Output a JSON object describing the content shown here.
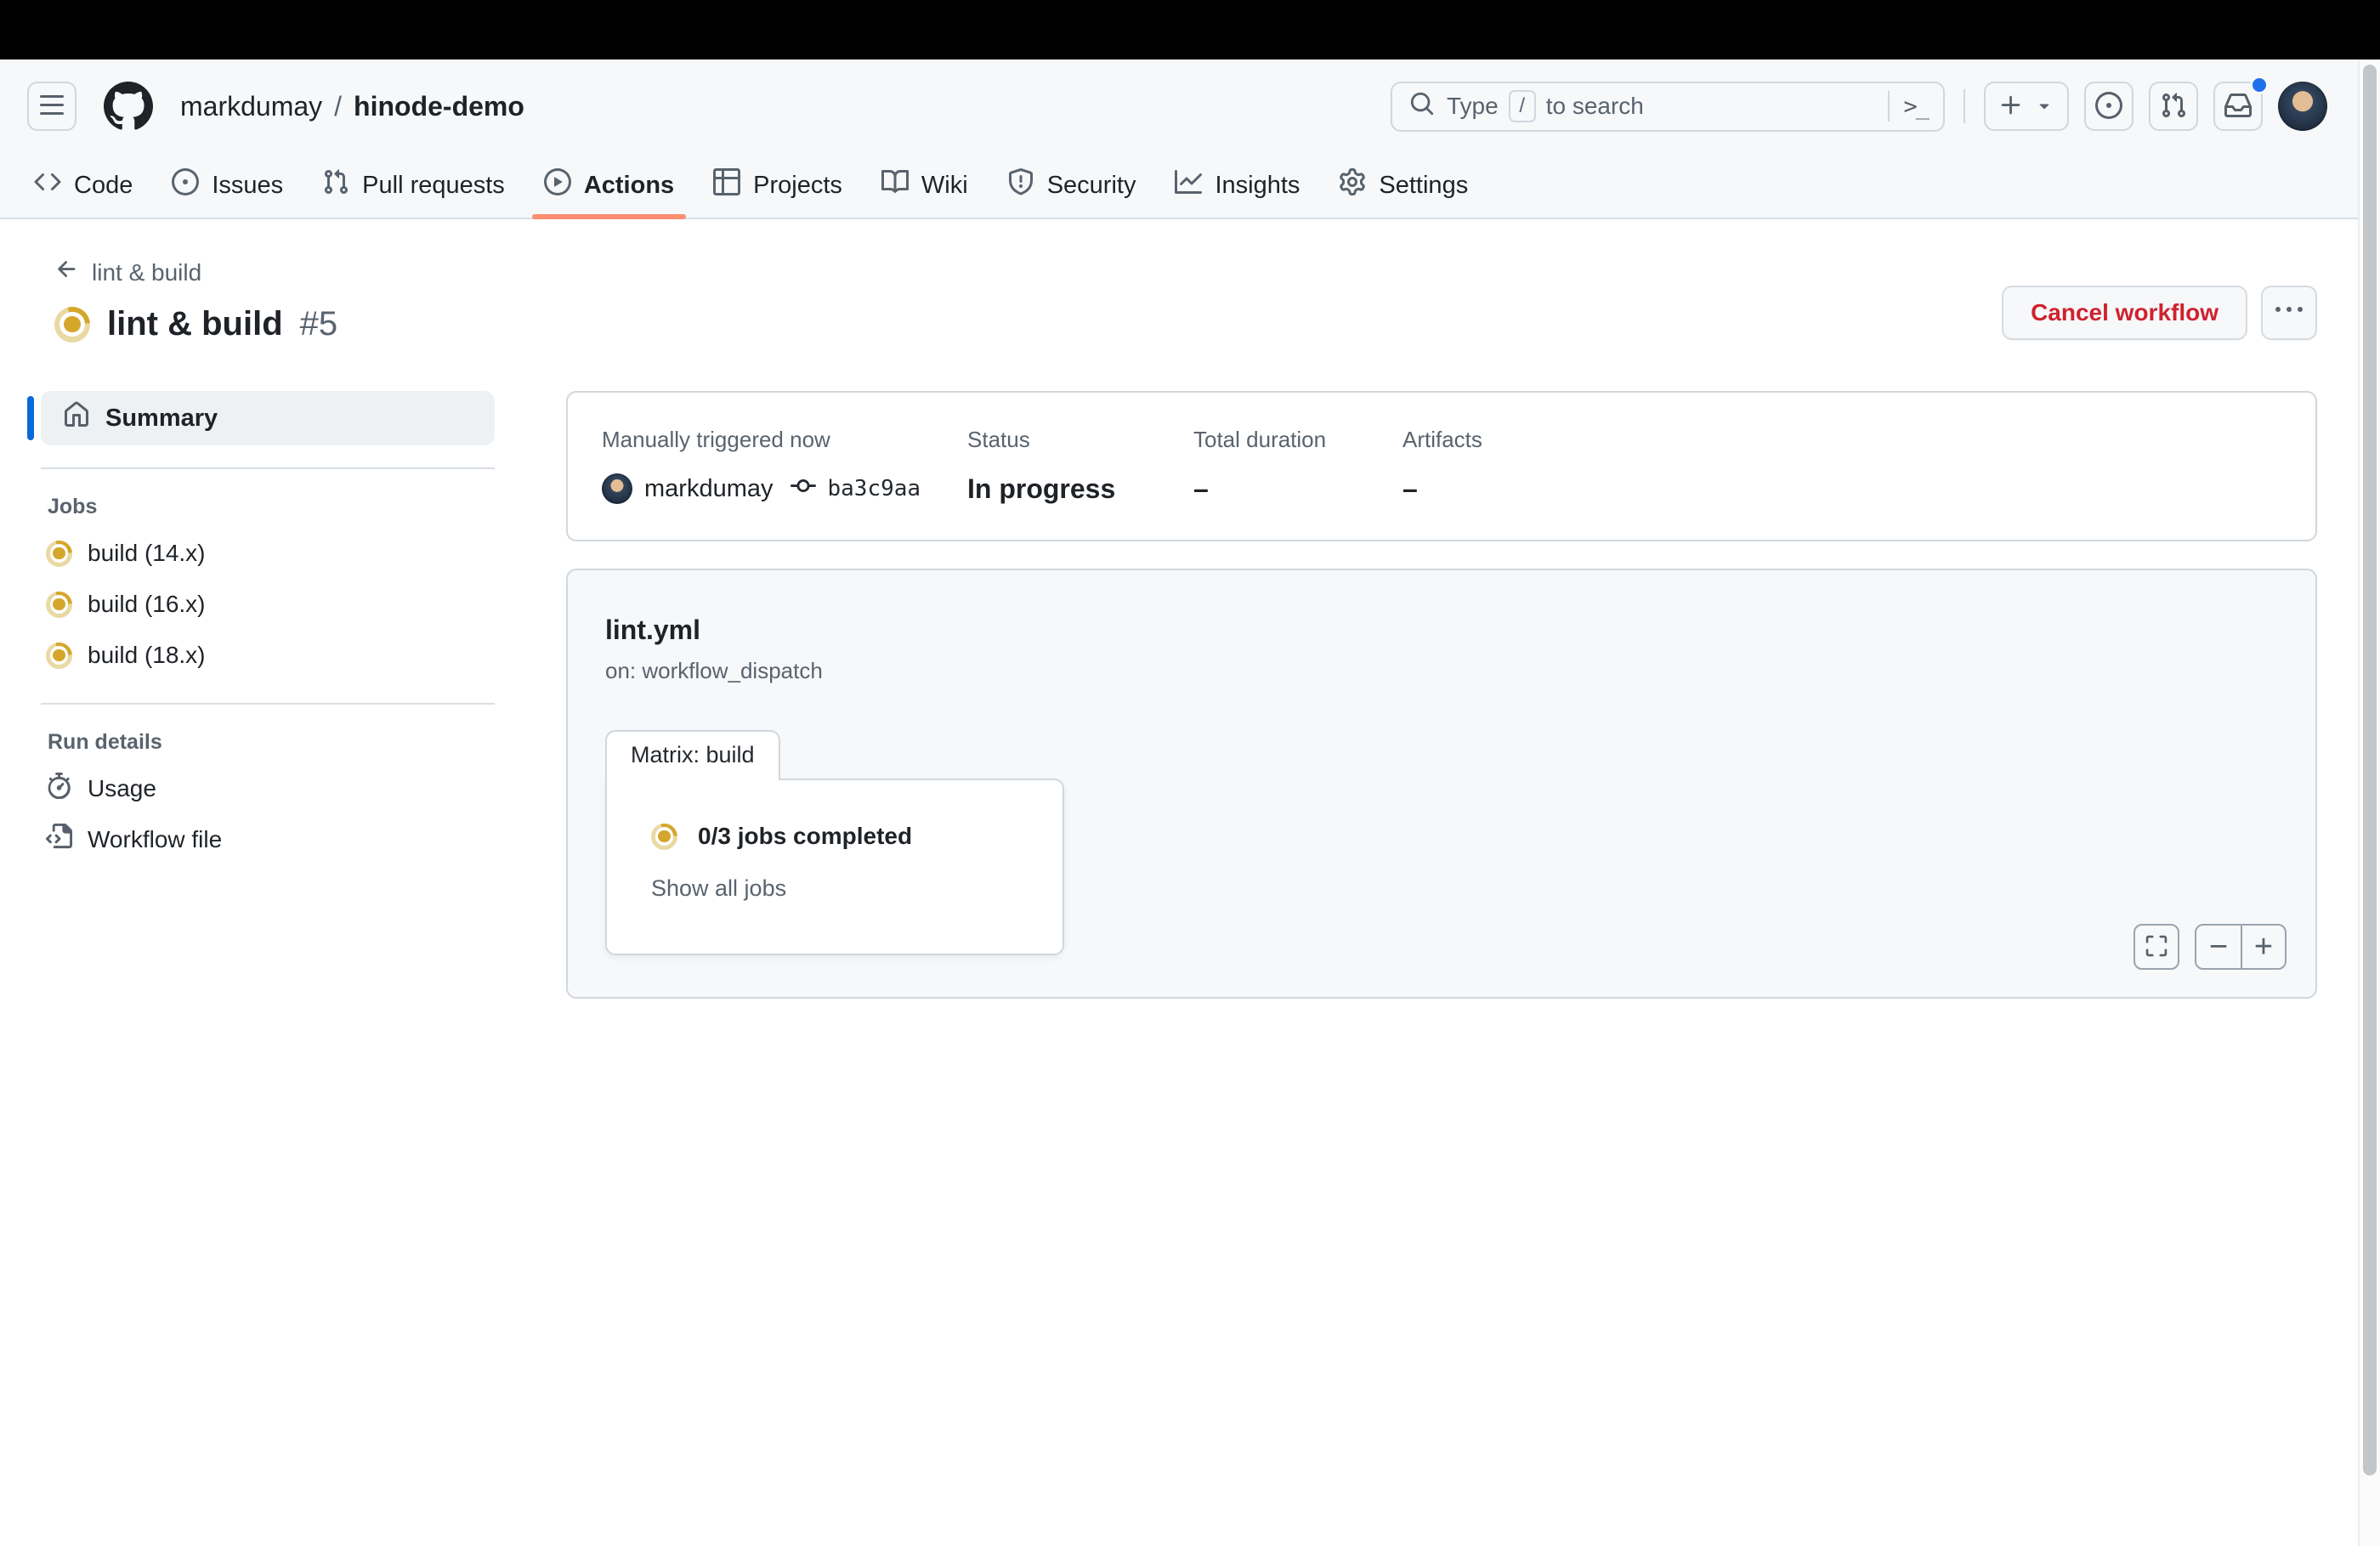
{
  "colors": {
    "accent_blue": "#0969da",
    "tab_underline_orange": "#fd8c73",
    "danger_red": "#cf222e",
    "in_progress_gold": "#d4a72c",
    "notification_dot_blue": "#1f6feb",
    "header_bg": "#f6f8fa",
    "border": "#d0d7de"
  },
  "header": {
    "breadcrumb": {
      "owner": "markdumay",
      "separator": "/",
      "repo": "hinode-demo"
    },
    "search": {
      "placeholder_prefix": "Type",
      "slash_key": "/",
      "placeholder_suffix": "to search",
      "command_glyph": ">_"
    }
  },
  "tabs": [
    {
      "label": "Code"
    },
    {
      "label": "Issues"
    },
    {
      "label": "Pull requests"
    },
    {
      "label": "Actions"
    },
    {
      "label": "Projects"
    },
    {
      "label": "Wiki"
    },
    {
      "label": "Security"
    },
    {
      "label": "Insights"
    },
    {
      "label": "Settings"
    }
  ],
  "run": {
    "back_label": "lint & build",
    "title": "lint & build",
    "run_number": "#5",
    "cancel_button": "Cancel workflow"
  },
  "sidebar": {
    "summary_label": "Summary",
    "jobs_heading": "Jobs",
    "jobs": [
      {
        "label": "build (14.x)"
      },
      {
        "label": "build (16.x)"
      },
      {
        "label": "build (18.x)"
      }
    ],
    "run_details_heading": "Run details",
    "usage_label": "Usage",
    "workflow_file_label": "Workflow file"
  },
  "summary_card": {
    "trigger_label": "Manually triggered now",
    "actor": "markdumay",
    "commit_sha": "ba3c9aa",
    "status_label": "Status",
    "status_value": "In progress",
    "duration_label": "Total duration",
    "duration_value": "–",
    "artifacts_label": "Artifacts",
    "artifacts_value": "–"
  },
  "graph": {
    "workflow_file": "lint.yml",
    "trigger_line": "on: workflow_dispatch",
    "matrix_tab_label": "Matrix: build",
    "node_status": "0/3 jobs completed",
    "show_all_jobs": "Show all jobs",
    "zoom_out_glyph": "−",
    "zoom_in_glyph": "+"
  }
}
